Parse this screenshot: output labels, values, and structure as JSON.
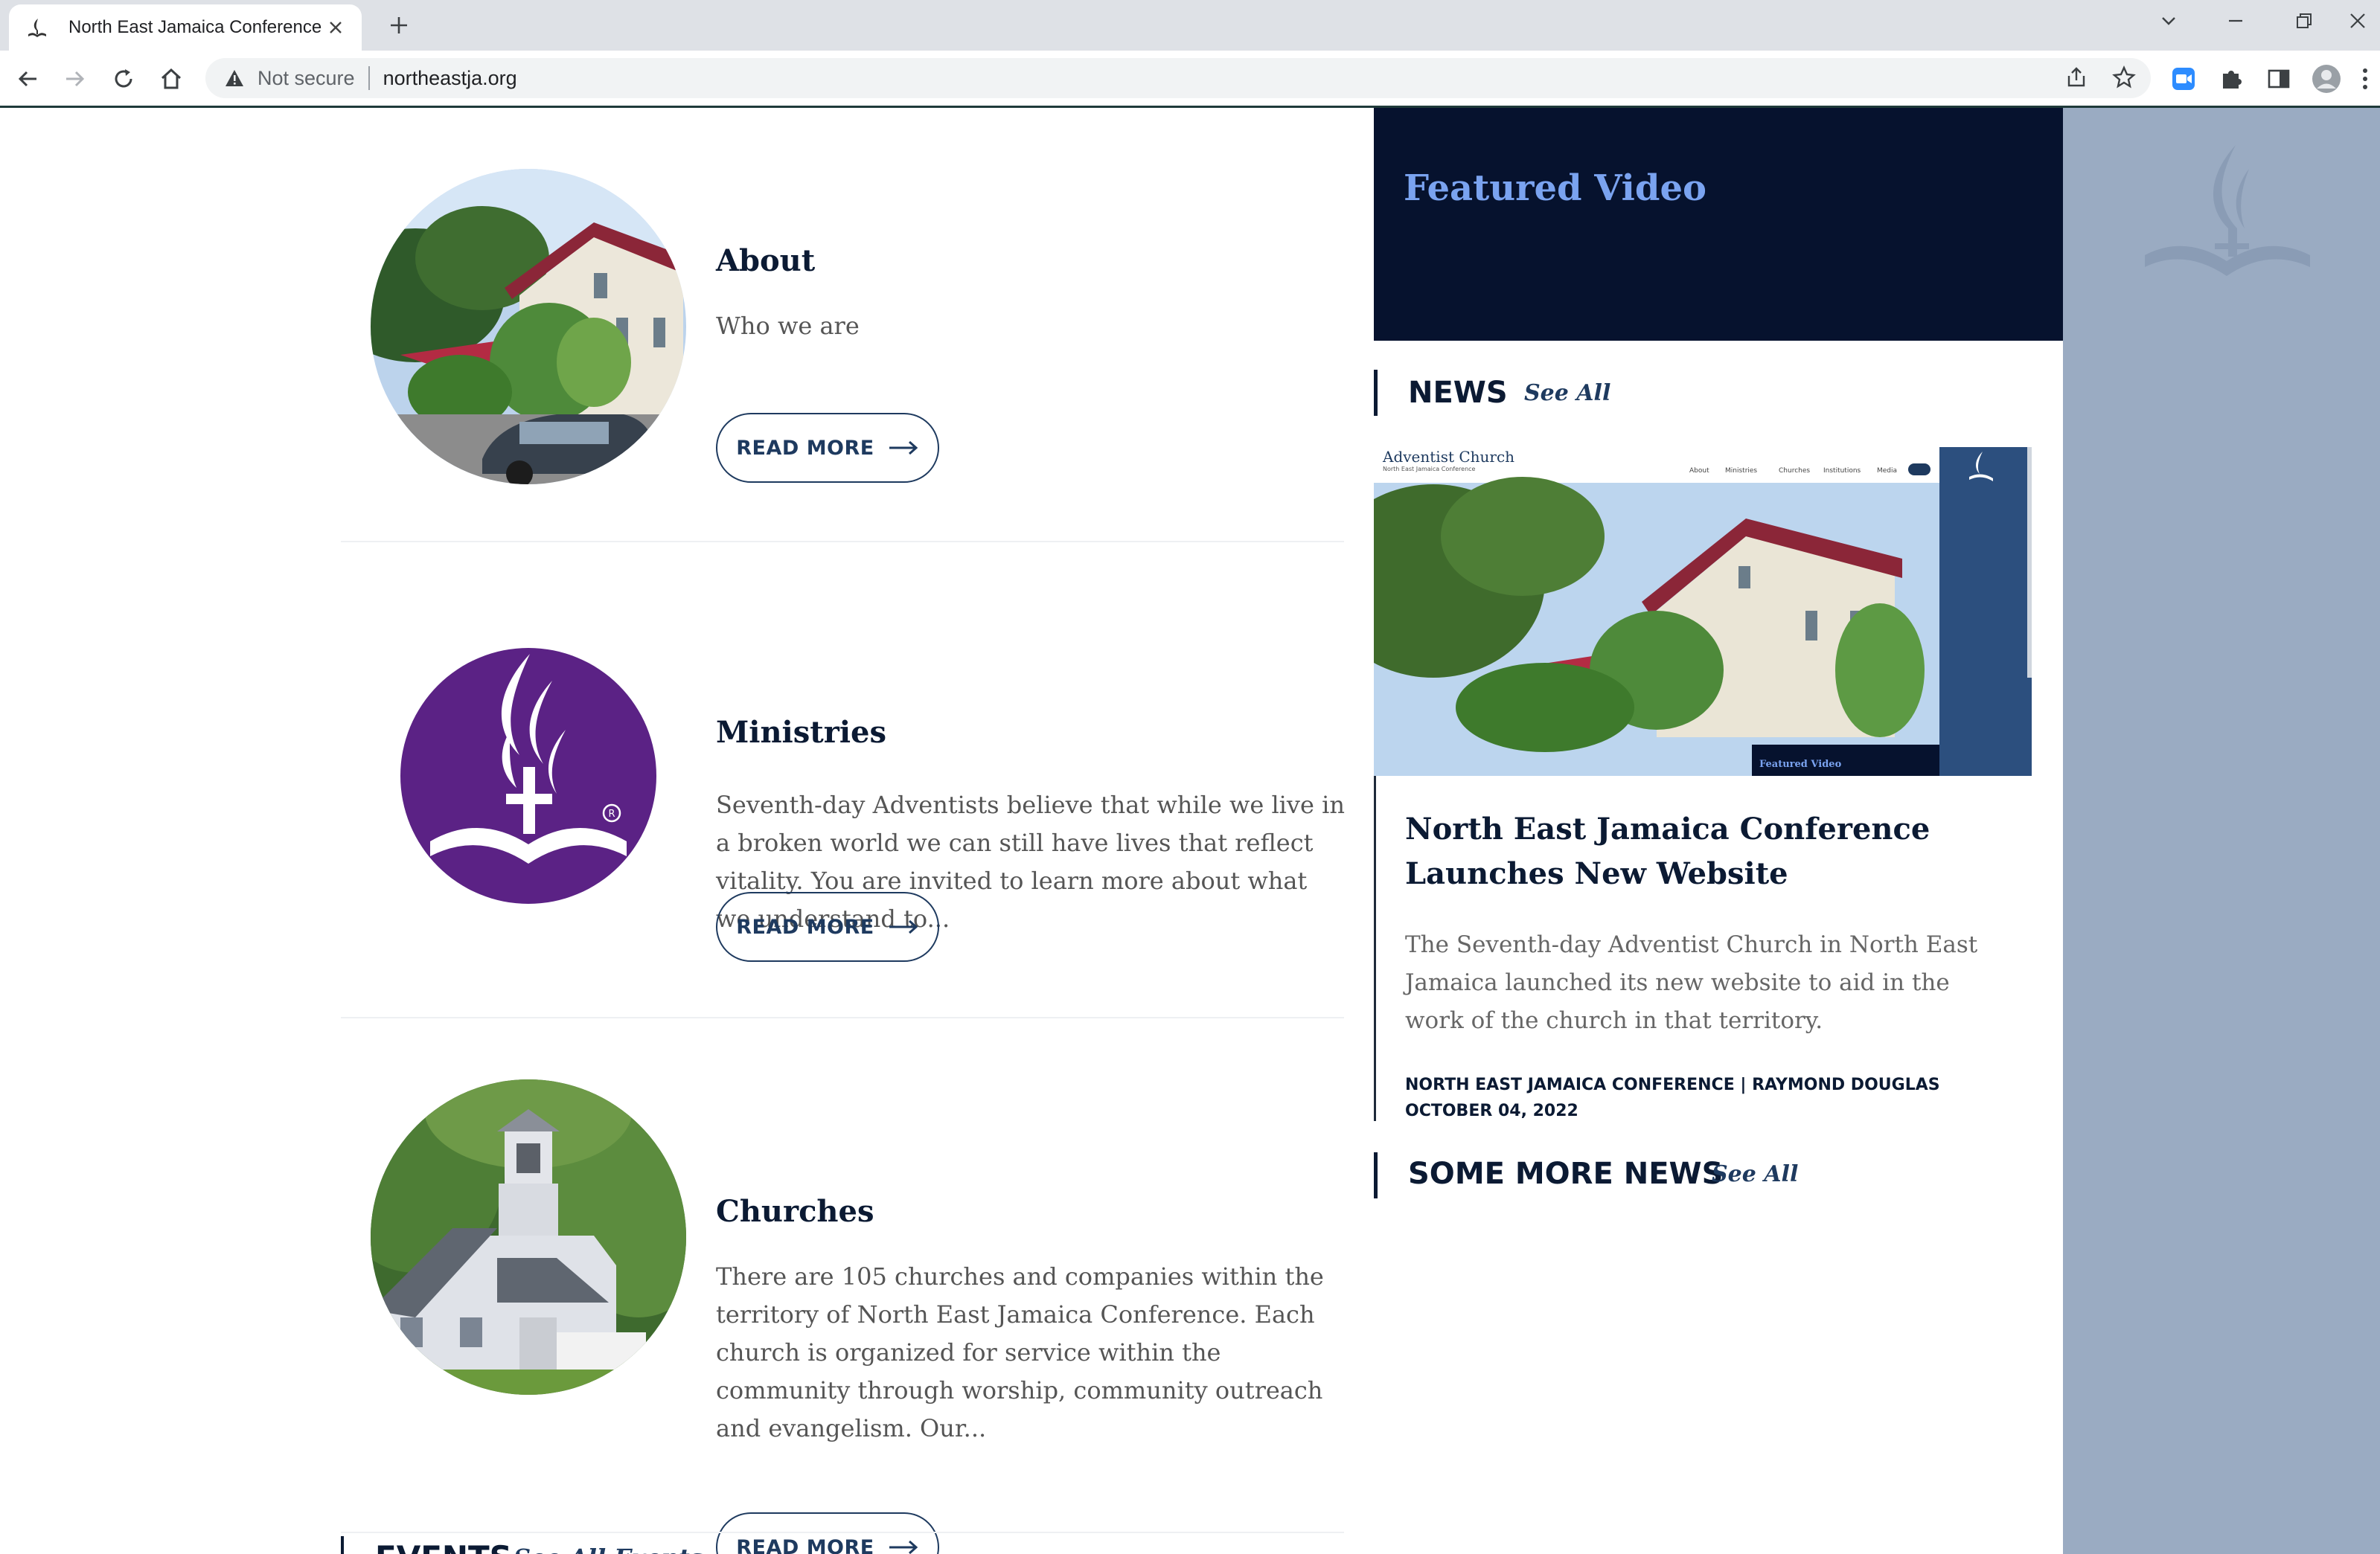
{
  "browser": {
    "tab_title": "North East Jamaica Conference",
    "security_label": "Not secure",
    "url": "northeastja.org"
  },
  "about": {
    "title": "About",
    "description": "Who we are",
    "button": "READ MORE"
  },
  "ministries": {
    "title": "Ministries",
    "description": "Seventh-day Adventists believe that while we live in a broken world we can still have lives that reflect vitality. You are invited to learn more about what we understand to...",
    "button": "READ MORE"
  },
  "churches": {
    "title": "Churches",
    "description": "There are 105 churches and companies within the territory of North East Jamaica Conference. Each church is organized for service within the community through worship, community outreach and evangelism. Our...",
    "button": "READ MORE"
  },
  "events": {
    "title": "EVENTS",
    "see_all": "See All Events"
  },
  "featured": {
    "title": "Featured Video"
  },
  "news": {
    "title": "NEWS",
    "see_all": "See All",
    "image_brand": "Adventist Church",
    "image_subbrand": "North East Jamaica Conference",
    "image_nav": [
      "About",
      "Ministries",
      "Churches",
      "Institutions",
      "Media"
    ],
    "image_caption": "Featured Video",
    "headline": "North East Jamaica Conference Launches New Website",
    "excerpt": "The Seventh-day Adventist Church in North East Jamaica launched its new website to aid in the work of the church in that territory.",
    "meta_author": "NORTH EAST JAMAICA CONFERENCE | RAYMOND DOUGLAS",
    "meta_date": "OCTOBER 04, 2022"
  },
  "more_news": {
    "title": "SOME MORE NEWS",
    "see_all": "See All"
  },
  "colors": {
    "navy": "#0b1a33",
    "featured_bg": "#06122e",
    "featured_title": "#7aa3f0",
    "button_border": "#1e3a5f",
    "ministries_purple": "#5b2285",
    "right_panel": "#9aabc2"
  }
}
